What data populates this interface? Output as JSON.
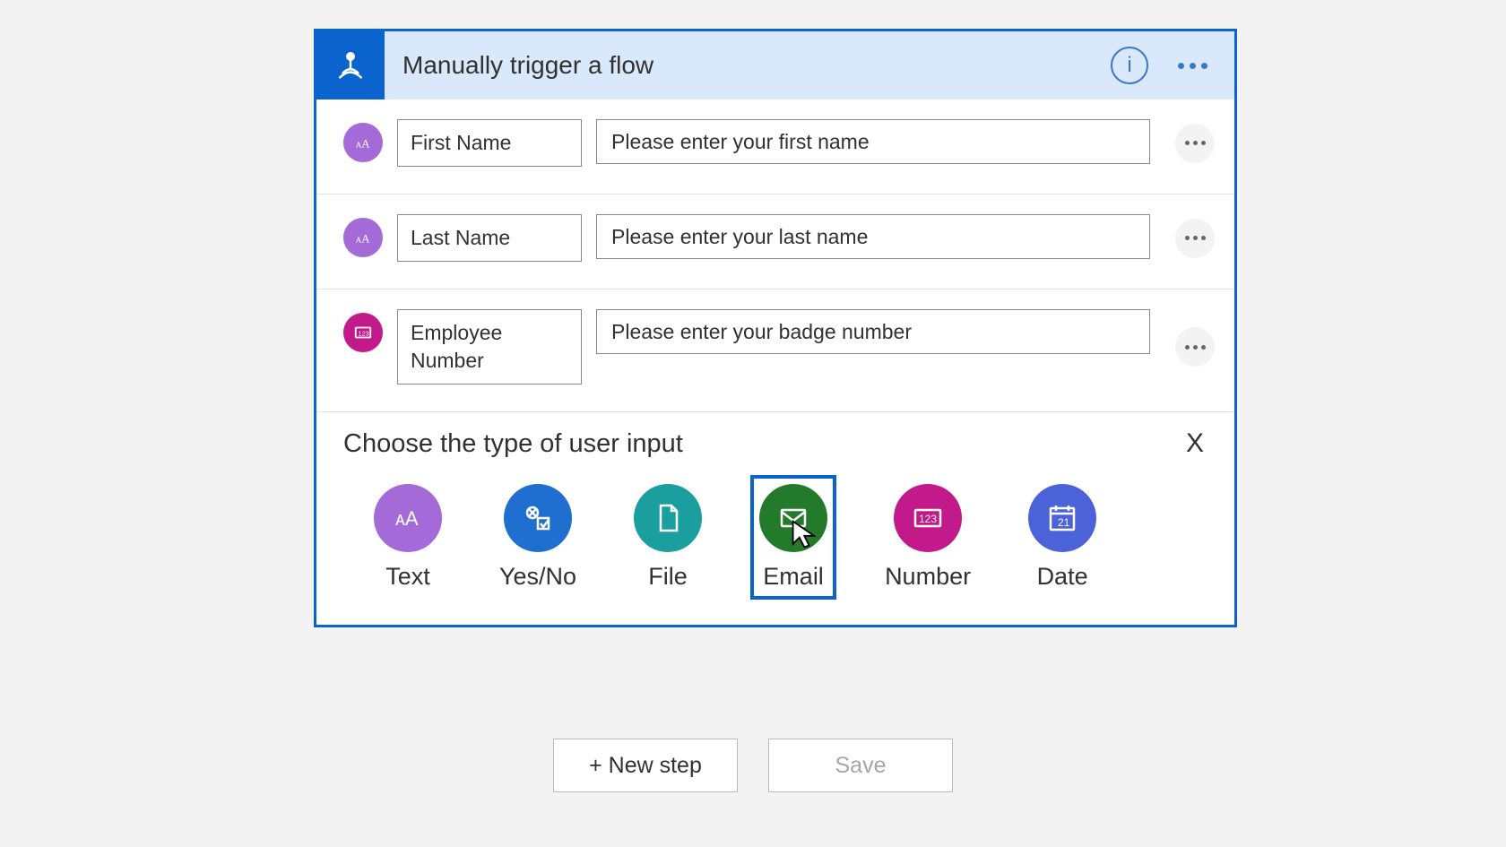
{
  "header": {
    "title": "Manually trigger a flow",
    "info_tooltip": "i"
  },
  "inputs": [
    {
      "icon": "text-icon",
      "icon_color": "purple",
      "label": "First Name",
      "placeholder": "Please enter your first name"
    },
    {
      "icon": "text-icon",
      "icon_color": "purple",
      "label": "Last Name",
      "placeholder": "Please enter your last name"
    },
    {
      "icon": "number-icon",
      "icon_color": "magenta",
      "label": "Employee Number",
      "placeholder": "Please enter your badge number"
    }
  ],
  "choose": {
    "title": "Choose the type of user input",
    "close_label": "X",
    "types": [
      {
        "key": "text",
        "label": "Text",
        "color": "c-purple",
        "selected": false
      },
      {
        "key": "yesno",
        "label": "Yes/No",
        "color": "c-blue",
        "selected": false
      },
      {
        "key": "file",
        "label": "File",
        "color": "c-teal",
        "selected": false
      },
      {
        "key": "email",
        "label": "Email",
        "color": "c-green",
        "selected": true
      },
      {
        "key": "number",
        "label": "Number",
        "color": "c-magenta",
        "selected": false
      },
      {
        "key": "date",
        "label": "Date",
        "color": "c-indigo",
        "selected": false
      }
    ]
  },
  "footer": {
    "new_step": "+ New step",
    "save": "Save"
  }
}
